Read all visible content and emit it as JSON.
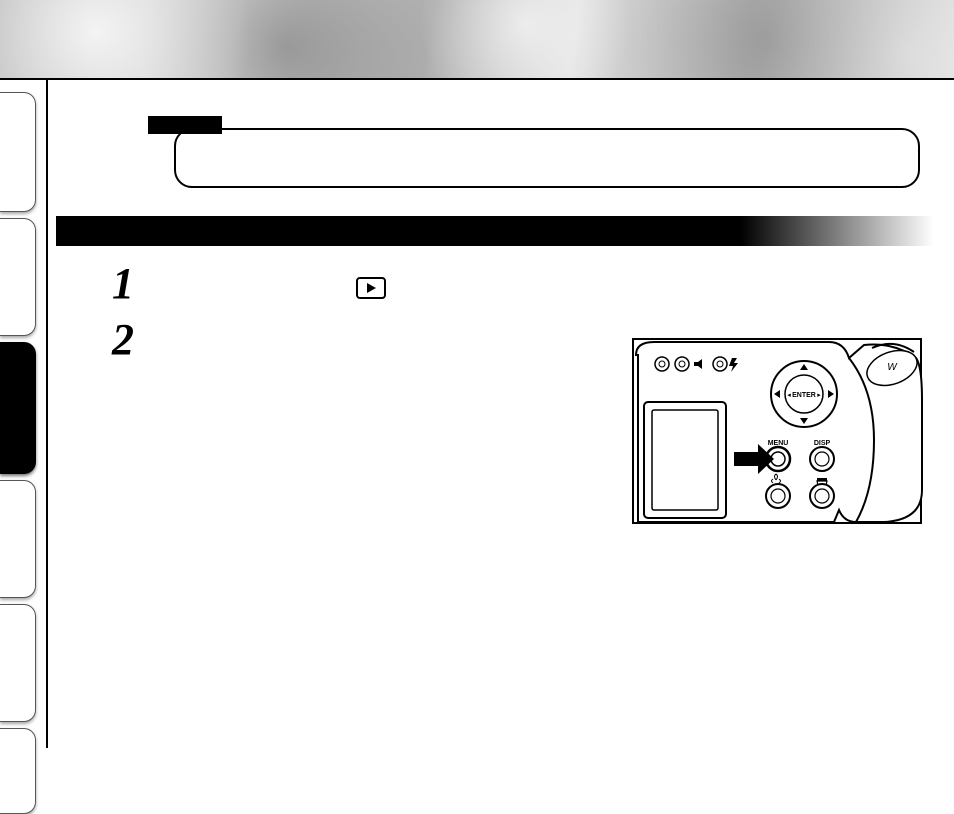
{
  "step1": "1",
  "step2": "2",
  "camera": {
    "enter_label": "ENTER",
    "menu_label": "MENU",
    "disp_label": "DISP",
    "mode_letter": "W"
  }
}
